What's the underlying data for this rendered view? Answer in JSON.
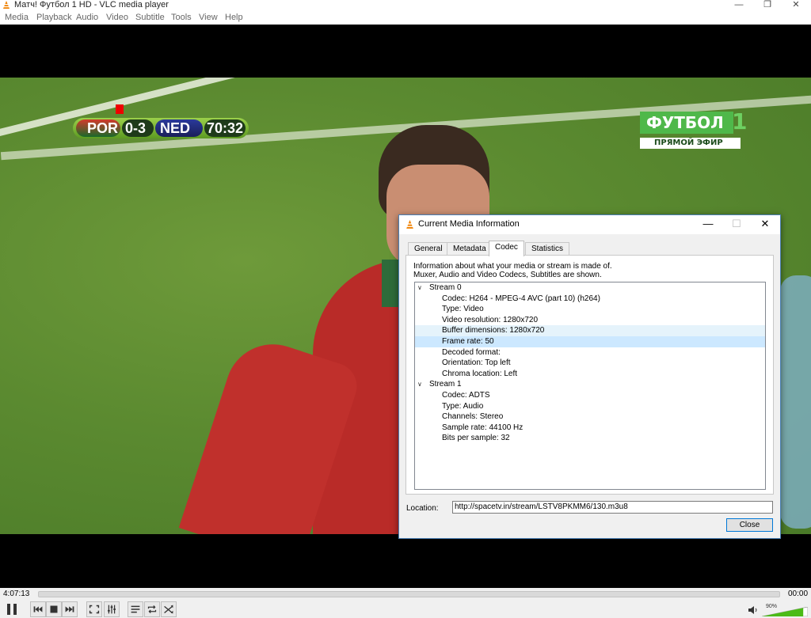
{
  "window": {
    "title": "Матч! Футбол 1 HD - VLC media player"
  },
  "menu": [
    "Media",
    "Playback",
    "Audio",
    "Video",
    "Subtitle",
    "Tools",
    "View",
    "Help"
  ],
  "video": {
    "scorebug": {
      "home": "POR",
      "score": "0-3",
      "away": "NED",
      "clock": "70:32"
    },
    "channel_logo": {
      "name": "ФУТБОЛ",
      "number": "1",
      "caption": "ПРЯМОЙ ЭФИР"
    }
  },
  "dialog": {
    "title": "Current Media Information",
    "tabs": [
      "General",
      "Metadata",
      "Codec",
      "Statistics"
    ],
    "active_tab": "Codec",
    "info_line1": "Information about what your media or stream is made of.",
    "info_line2": "Muxer, Audio and Video Codecs, Subtitles are shown.",
    "streams": [
      {
        "name": "Stream 0",
        "props": [
          "Codec: H264 - MPEG-4 AVC (part 10) (h264)",
          "Type: Video",
          "Video resolution: 1280x720",
          "Buffer dimensions: 1280x720",
          "Frame rate: 50",
          "Decoded format:",
          "Orientation: Top left",
          "Chroma location: Left"
        ]
      },
      {
        "name": "Stream 1",
        "props": [
          "Codec: ADTS",
          "Type: Audio",
          "Channels: Stereo",
          "Sample rate: 44100 Hz",
          "Bits per sample: 32"
        ]
      }
    ],
    "hovered_row": "Buffer dimensions: 1280x720",
    "selected_row": "Frame rate: 50",
    "location_label": "Location:",
    "location_value": "http://spacetv.in/stream/LSTV8PKMM6/130.m3u8",
    "close_label": "Close"
  },
  "player": {
    "elapsed": "4:07:13",
    "remaining": "00:00",
    "volume": "90%",
    "volume_level": 0.9
  }
}
